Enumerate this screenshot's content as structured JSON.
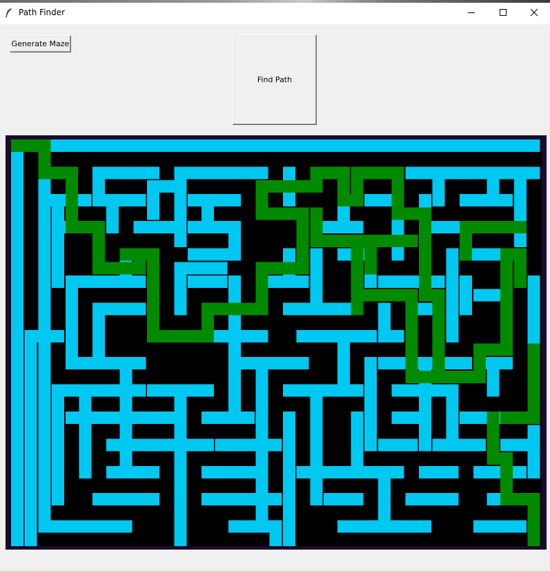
{
  "window": {
    "title": "Path Finder",
    "icon": "feather-icon",
    "controls": [
      "minimize-icon",
      "maximize-icon",
      "close-icon"
    ]
  },
  "toolbar": {
    "generate_label": "Generate Maze",
    "find_label": "Find Path"
  },
  "maze": {
    "colors": {
      "wall": "#000000",
      "passage": "#00c8f0",
      "path": "#008a00",
      "border": "#1a0a2b"
    }
  }
}
